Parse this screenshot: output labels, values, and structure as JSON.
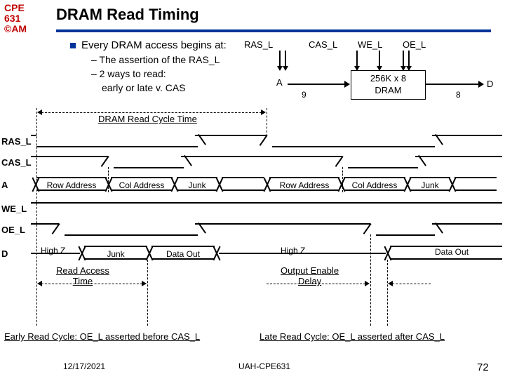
{
  "logo": {
    "l1": "CPE",
    "l2": "631",
    "l3": "©AM"
  },
  "title": "DRAM Read Timing",
  "bullet": "Every DRAM access begins at:",
  "sub1": "– The assertion of the RAS_L",
  "sub2": "– 2 ways to read:",
  "sub3": "early or late v. CAS",
  "ports": {
    "ras": "RAS_L",
    "cas": "CAS_L",
    "we": "WE_L",
    "oe": "OE_L",
    "a": "A",
    "nine": "9",
    "eight": "8",
    "d": "D"
  },
  "drambox": {
    "l1": "256K x 8",
    "l2": "DRAM"
  },
  "timing_labels": {
    "ras": "RAS_L",
    "cas": "CAS_L",
    "a": "A",
    "we": "WE_L",
    "oe": "OE_L",
    "d": "D"
  },
  "cycle_label": "DRAM Read Cycle Time",
  "a_bus": [
    "Row Address",
    "Col Address",
    "Junk",
    "Row Address",
    "Col Address",
    "Junk"
  ],
  "d_bus": [
    "High Z",
    "Junk",
    "Data Out",
    "High Z",
    "Data Out"
  ],
  "read_access": "Read Access",
  "time": "Time",
  "oe_delay_l1": "Output Enable",
  "oe_delay_l2": "Delay",
  "caption_early": "Early Read Cycle: OE_L asserted before CAS_L",
  "caption_late": "Late Read Cycle: OE_L asserted after CAS_L",
  "footer": {
    "date": "12/17/2021",
    "center": "UAH-CPE631",
    "page": "72"
  },
  "chart_data": {
    "type": "timing-diagram",
    "title": "DRAM Read Timing",
    "signals": [
      {
        "name": "RAS_L",
        "kind": "digital",
        "events": [
          {
            "t": 0,
            "v": 1
          },
          {
            "t": 1,
            "v": 0
          },
          {
            "t": 6,
            "v": 1
          },
          {
            "t": 8,
            "v": 0
          },
          {
            "t": 13,
            "v": 1
          }
        ]
      },
      {
        "name": "CAS_L",
        "kind": "digital",
        "events": [
          {
            "t": 0,
            "v": 1
          },
          {
            "t": 3,
            "v": 0
          },
          {
            "t": 5.5,
            "v": 1
          },
          {
            "t": 10,
            "v": 0
          },
          {
            "t": 12.5,
            "v": 1
          }
        ]
      },
      {
        "name": "A",
        "kind": "bus",
        "segments": [
          {
            "t0": 0,
            "t1": 3,
            "label": "Row Address"
          },
          {
            "t0": 3,
            "t1": 5,
            "label": "Col Address"
          },
          {
            "t0": 5,
            "t1": 7,
            "label": "Junk"
          },
          {
            "t0": 7,
            "t1": 10,
            "label": "Row Address"
          },
          {
            "t0": 10,
            "t1": 12,
            "label": "Col Address"
          },
          {
            "t0": 12,
            "t1": 14,
            "label": "Junk"
          }
        ]
      },
      {
        "name": "WE_L",
        "kind": "digital",
        "events": [
          {
            "t": 0,
            "v": 1
          }
        ]
      },
      {
        "name": "OE_L",
        "kind": "digital",
        "events": [
          {
            "t": 0,
            "v": 1
          },
          {
            "t": 1.5,
            "v": 0
          },
          {
            "t": 6,
            "v": 1
          },
          {
            "t": 11,
            "v": 0
          },
          {
            "t": 13,
            "v": 1
          }
        ]
      },
      {
        "name": "D",
        "kind": "bus",
        "segments": [
          {
            "t0": 0,
            "t1": 2,
            "label": "High Z"
          },
          {
            "t0": 2,
            "t1": 4.5,
            "label": "Junk"
          },
          {
            "t0": 4.5,
            "t1": 7,
            "label": "Data Out"
          },
          {
            "t0": 7,
            "t1": 11,
            "label": "High Z"
          },
          {
            "t0": 11,
            "t1": 14,
            "label": "Data Out"
          }
        ]
      }
    ],
    "intervals": [
      {
        "name": "DRAM Read Cycle Time",
        "from": "RAS_L fall 1",
        "to": "RAS_L fall 2"
      },
      {
        "name": "Read Access Time",
        "from": "RAS_L fall 1",
        "to": "D valid 1"
      },
      {
        "name": "Output Enable Delay",
        "from": "OE_L fall 2",
        "to": "D valid 2"
      }
    ],
    "notes": [
      "Early Read Cycle: OE_L asserted before CAS_L",
      "Late Read Cycle: OE_L asserted after CAS_L"
    ]
  }
}
